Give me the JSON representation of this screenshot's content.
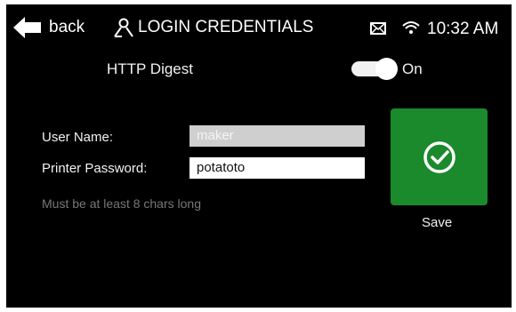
{
  "header": {
    "back_label": "back",
    "title": "LOGIN CREDENTIALS",
    "time": "10:32 AM",
    "icons": [
      "back-arrow-icon",
      "user-icon",
      "mail-icon",
      "wifi-icon"
    ]
  },
  "digest": {
    "label": "HTTP Digest",
    "toggle_state": "On",
    "enabled": true
  },
  "form": {
    "username_label": "User Name:",
    "username_value": "maker",
    "password_label": "Printer Password:",
    "password_value": "potatoto",
    "hint": "Must be at least 8 chars long"
  },
  "save": {
    "label": "Save",
    "icon": "check-circle-icon",
    "color": "#1a8a2c"
  }
}
